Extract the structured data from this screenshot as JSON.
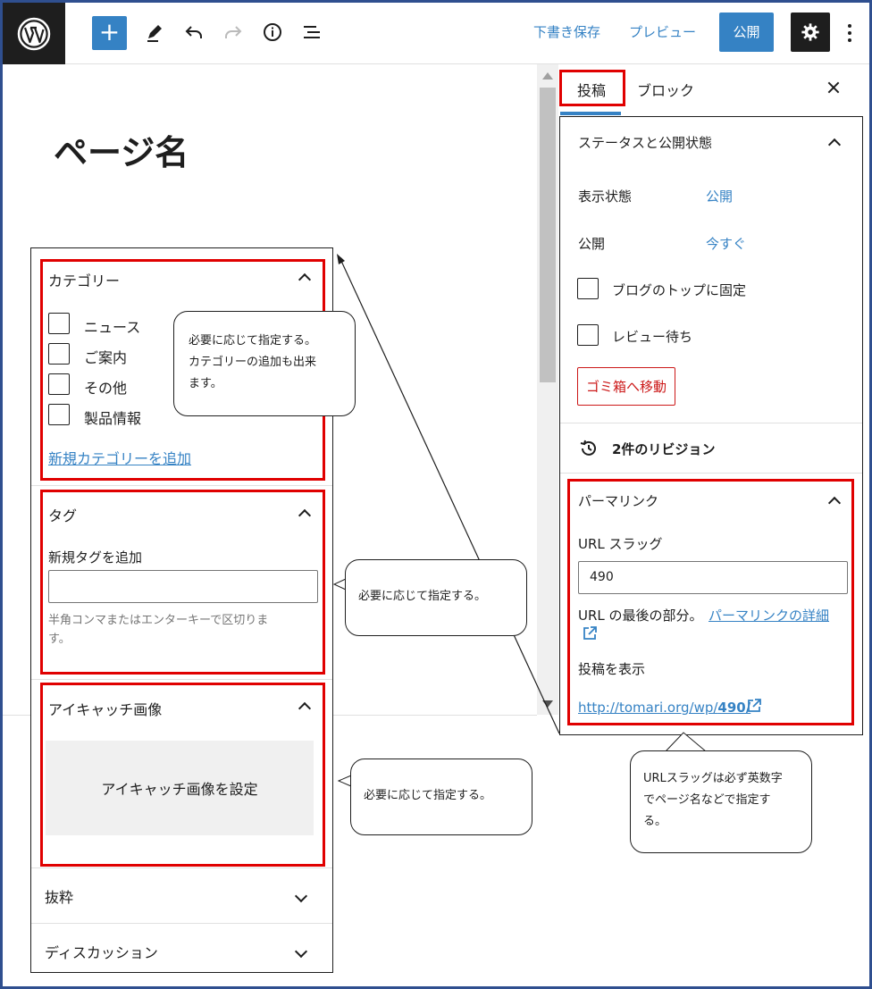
{
  "topbar": {
    "save_draft": "下書き保存",
    "preview": "プレビュー",
    "publish": "公開",
    "add_symbol": "+"
  },
  "editor": {
    "page_title": "ページ名"
  },
  "left_panel": {
    "category": {
      "title": "カテゴリー",
      "items": [
        "ニュース",
        "ご案内",
        "その他",
        "製品情報"
      ],
      "add_link": "新規カテゴリーを追加"
    },
    "tag": {
      "title": "タグ",
      "add_label": "新規タグを追加",
      "input_value": "",
      "help": "半角コンマまたはエンターキーで区切りま",
      "help2": "す。"
    },
    "featured_image": {
      "title": "アイキャッチ画像",
      "set_button": "アイキャッチ画像を設定"
    },
    "excerpt": {
      "title": "抜粋"
    },
    "discussion": {
      "title": "ディスカッション"
    }
  },
  "sidebar": {
    "tabs": [
      "投稿",
      "ブロック"
    ],
    "status": {
      "title": "ステータスと公開状態",
      "visibility_label": "表示状態",
      "visibility_value": "公開",
      "publish_label": "公開",
      "publish_value": "今すぐ",
      "sticky_label": "ブログのトップに固定",
      "pending_label": "レビュー待ち",
      "trash_button": "ゴミ箱へ移動"
    },
    "revisions": "2件のリビジョン",
    "permalink": {
      "title": "パーマリンク",
      "slug_label": "URL スラッグ",
      "slug_value": "490",
      "desc": "URL の最後の部分。",
      "detail_link": "パーマリンクの詳細",
      "view_label": "投稿を表示",
      "url_prefix": "http://tomari.org/wp/",
      "url_suffix": "490/"
    }
  },
  "callouts": {
    "category_line1": "必要に応じて指定する。",
    "category_line2": "カテゴリーの追加も出来",
    "category_line3": "ます。",
    "tag": "必要に応じて指定する。",
    "image": "必要に応じて指定する。",
    "slug_line1": "URLスラッグは必ず英数字",
    "slug_line2": "でページ名などで指定す",
    "slug_line3": "る。"
  },
  "colors": {
    "accent": "#3582c4",
    "dark": "#1e1e1e",
    "highlight": "#e00000",
    "danger": "#cc1818",
    "frame": "#2f4f8f"
  }
}
